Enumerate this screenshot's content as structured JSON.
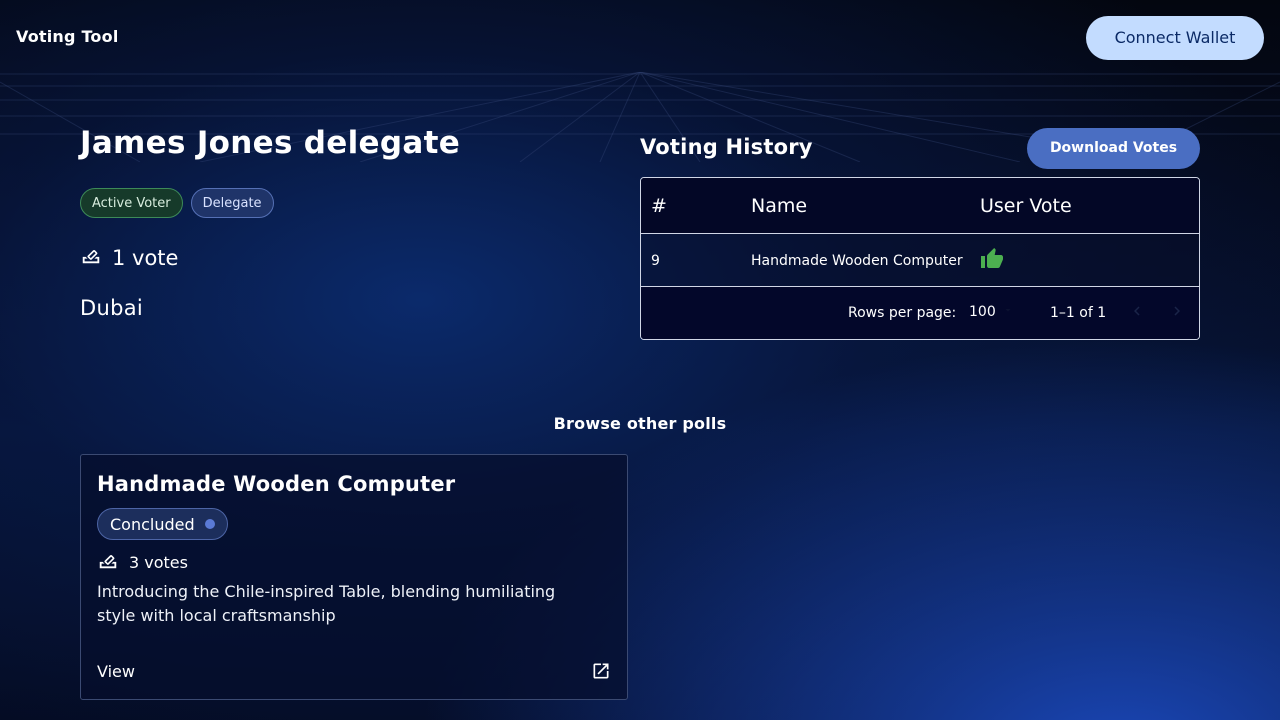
{
  "header": {
    "app_title": "Voting Tool",
    "connect_wallet_label": "Connect Wallet"
  },
  "profile": {
    "name": "James Jones delegate",
    "badges": [
      "Active Voter",
      "Delegate"
    ],
    "votes_text": "1 vote",
    "location": "Dubai",
    "icons": {
      "votes": "ballot-box-icon"
    }
  },
  "history": {
    "title": "Voting History",
    "download_label": "Download Votes",
    "columns": [
      "#",
      "Name",
      "User Vote"
    ],
    "rows": [
      {
        "number": "9",
        "name": "Handmade Wooden Computer",
        "vote_icon": "thumbs-up-icon"
      }
    ],
    "footer": {
      "rows_per_page_label": "Rows per page:",
      "rows_per_page_value": "100",
      "range": "1–1 of 1"
    }
  },
  "browse": {
    "title": "Browse other polls",
    "polls": [
      {
        "title": "Handmade Wooden Computer",
        "status": "Concluded",
        "votes_text": "3 votes",
        "description": "Introducing the Chile-inspired Table, blending humiliating style with local craftsmanship",
        "view_label": "View"
      }
    ]
  },
  "colors": {
    "connect_button": "#c3dcff",
    "download_button": "#4a6ec2",
    "thumbs_up": "#4caf50",
    "status_dot": "#5a7ad6"
  }
}
